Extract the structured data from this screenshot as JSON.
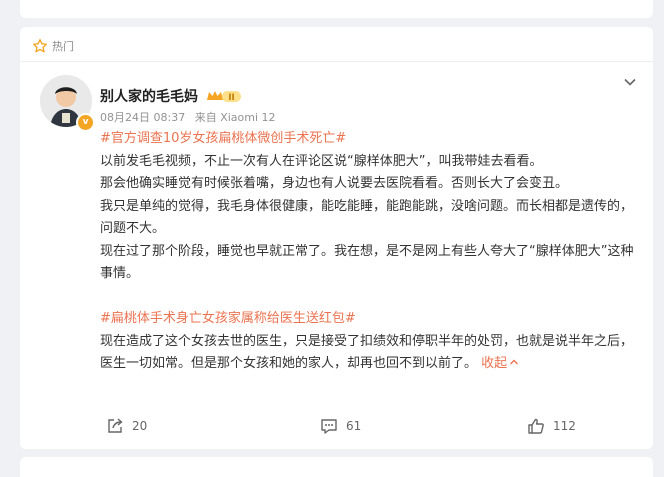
{
  "hot": {
    "label": "热门"
  },
  "post": {
    "author": "别人家的毛毛妈",
    "level_badge": "II",
    "time": "08月24日 08:37",
    "source": "来自 Xiaomi 12",
    "paragraphs": [
      {
        "type": "topic",
        "text": "#官方调查10岁女孩扁桃体微创手术死亡#"
      },
      {
        "type": "text",
        "text": "以前发毛毛视频，不止一次有人在评论区说“腺样体肥大”，叫我带娃去看看。"
      },
      {
        "type": "text",
        "text": "那会他确实睡觉有时候张着嘴，身边也有人说要去医院看看。否则长大了会变丑。"
      },
      {
        "type": "text",
        "text": "我只是单纯的觉得，我毛身体很健康，能吃能睡，能跑能跳，没啥问题。而长相都是遗传的，问题不大。"
      },
      {
        "type": "text",
        "text": "现在过了那个阶段，睡觉也早就正常了。我在想，是不是网上有些人夸大了“腺样体肥大”这种事情。"
      },
      {
        "type": "blank",
        "text": ""
      },
      {
        "type": "topic",
        "text": "#扁桃体手术身亡女孩家属称给医生送红包#"
      },
      {
        "type": "text",
        "text": "现在造成了这个女孩去世的医生，只是接受了扣绩效和停职半年的处罚，也就是说半年之后，医生一切如常。但是那个女孩和她的家人，却再也回不到以前了。"
      }
    ],
    "collapse_label": "收起"
  },
  "actions": {
    "share_count": "20",
    "comment_count": "61",
    "like_count": "112"
  },
  "colors": {
    "accent": "#eb7350",
    "page_bg": "#f0f1f4",
    "card_bg": "#ffffff",
    "meta": "#939393",
    "badge": "#f5a524"
  },
  "icons": [
    "star-icon",
    "chevron-down-icon",
    "verified-icon",
    "level-badge-icon",
    "share-icon",
    "comment-icon",
    "like-icon"
  ]
}
